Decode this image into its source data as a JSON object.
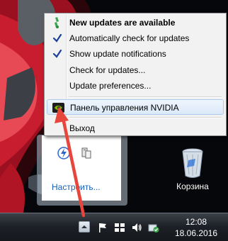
{
  "context_menu": {
    "items": [
      {
        "label": "New updates are available",
        "icon": "nvidia-update-icon"
      },
      {
        "label": "Automatically check for updates",
        "icon": "checkmark-icon"
      },
      {
        "label": "Show update notifications",
        "icon": "checkmark-icon"
      },
      {
        "label": "Check for updates..."
      },
      {
        "label": "Update preferences..."
      },
      {
        "label": "Панель управления NVIDIA",
        "icon": "nvidia-logo-icon"
      },
      {
        "label": "Выход"
      }
    ]
  },
  "tray_overflow": {
    "customize_label": "Настроить...",
    "icons": [
      "power-icon",
      "network-device-icon"
    ]
  },
  "desktop": {
    "recycle_bin_label": "Корзина"
  },
  "taskbar": {
    "time": "12:08",
    "date": "18.06.2016",
    "icons": [
      "show-hidden-icons-button",
      "flag-icon",
      "network-icon",
      "volume-icon",
      "update-shield-icon"
    ]
  },
  "colors": {
    "menu_highlight": "#dbe9f8",
    "annotation_arrow": "#e8453c",
    "link": "#1a5fb4"
  }
}
